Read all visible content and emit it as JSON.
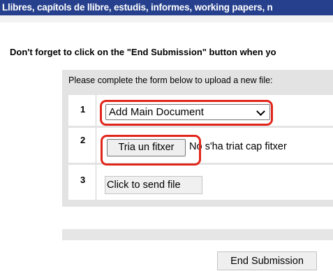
{
  "banner": {
    "title": "Llibres, capítols de llibre, estudis, informes, working papers, n"
  },
  "reminder_text": "Don't forget to click on the \"End Submission\" button when yo",
  "form": {
    "instruction": "Please complete the form below to upload a new file:",
    "steps": [
      {
        "number": "1",
        "select_value": "Add Main Document"
      },
      {
        "number": "2",
        "file_button_label": "Tria un fitxer",
        "file_status": "No s'ha triat cap fitxer"
      },
      {
        "number": "3",
        "send_button_label": "Click to send file"
      }
    ]
  },
  "end_submission_label": "End Submission",
  "colors": {
    "banner_bg": "#26408d",
    "highlight": "#e1251b",
    "panel_bg": "#e3e3e3"
  },
  "icons": {
    "select_arrow": "chevron-down-icon"
  }
}
